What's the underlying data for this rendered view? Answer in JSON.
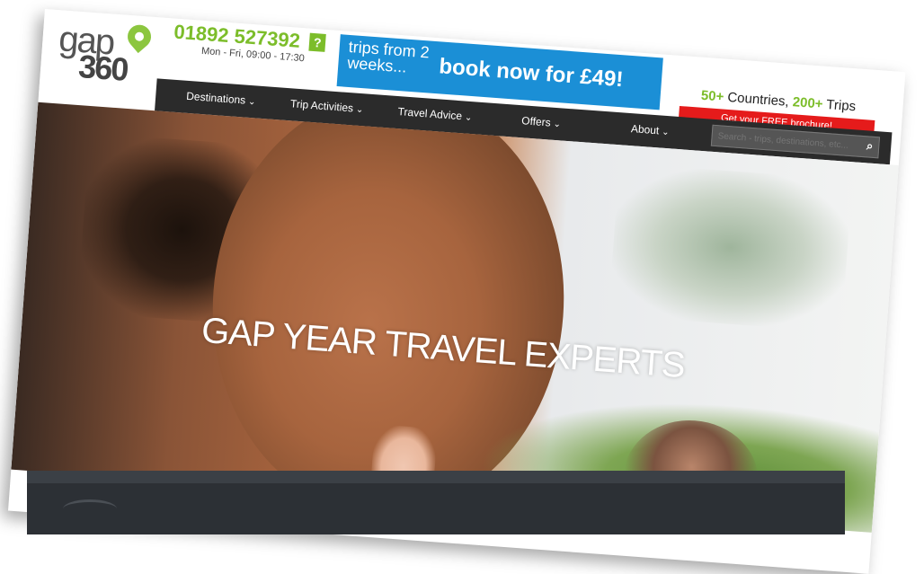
{
  "header": {
    "logo": {
      "top": "gap",
      "bottom": "360"
    },
    "phone": {
      "number": "01892 527392",
      "help_icon": "?",
      "hours": "Mon - Fri, 09:00 - 17:30"
    },
    "banner": {
      "small": "trips from 2 weeks...",
      "big": "book now for £49!"
    },
    "countries": {
      "count1": "50+",
      "label1": " Countries, ",
      "count2": "200+",
      "label2": " Trips"
    },
    "brochure_label": "Get your FREE brochure!"
  },
  "nav": {
    "items": [
      {
        "label": "Destinations"
      },
      {
        "label": "Trip Activities"
      },
      {
        "label": "Travel Advice"
      },
      {
        "label": "Offers"
      },
      {
        "label": "About"
      }
    ],
    "search_placeholder": "Search - trips, destinations, etc..."
  },
  "hero": {
    "title": "GAP YEAR TRAVEL EXPERTS"
  },
  "colors": {
    "brand_green": "#7cbd2a",
    "banner_blue": "#1b8fd6",
    "brochure_red": "#e51b1b",
    "nav_dark": "#2b2b2b"
  }
}
